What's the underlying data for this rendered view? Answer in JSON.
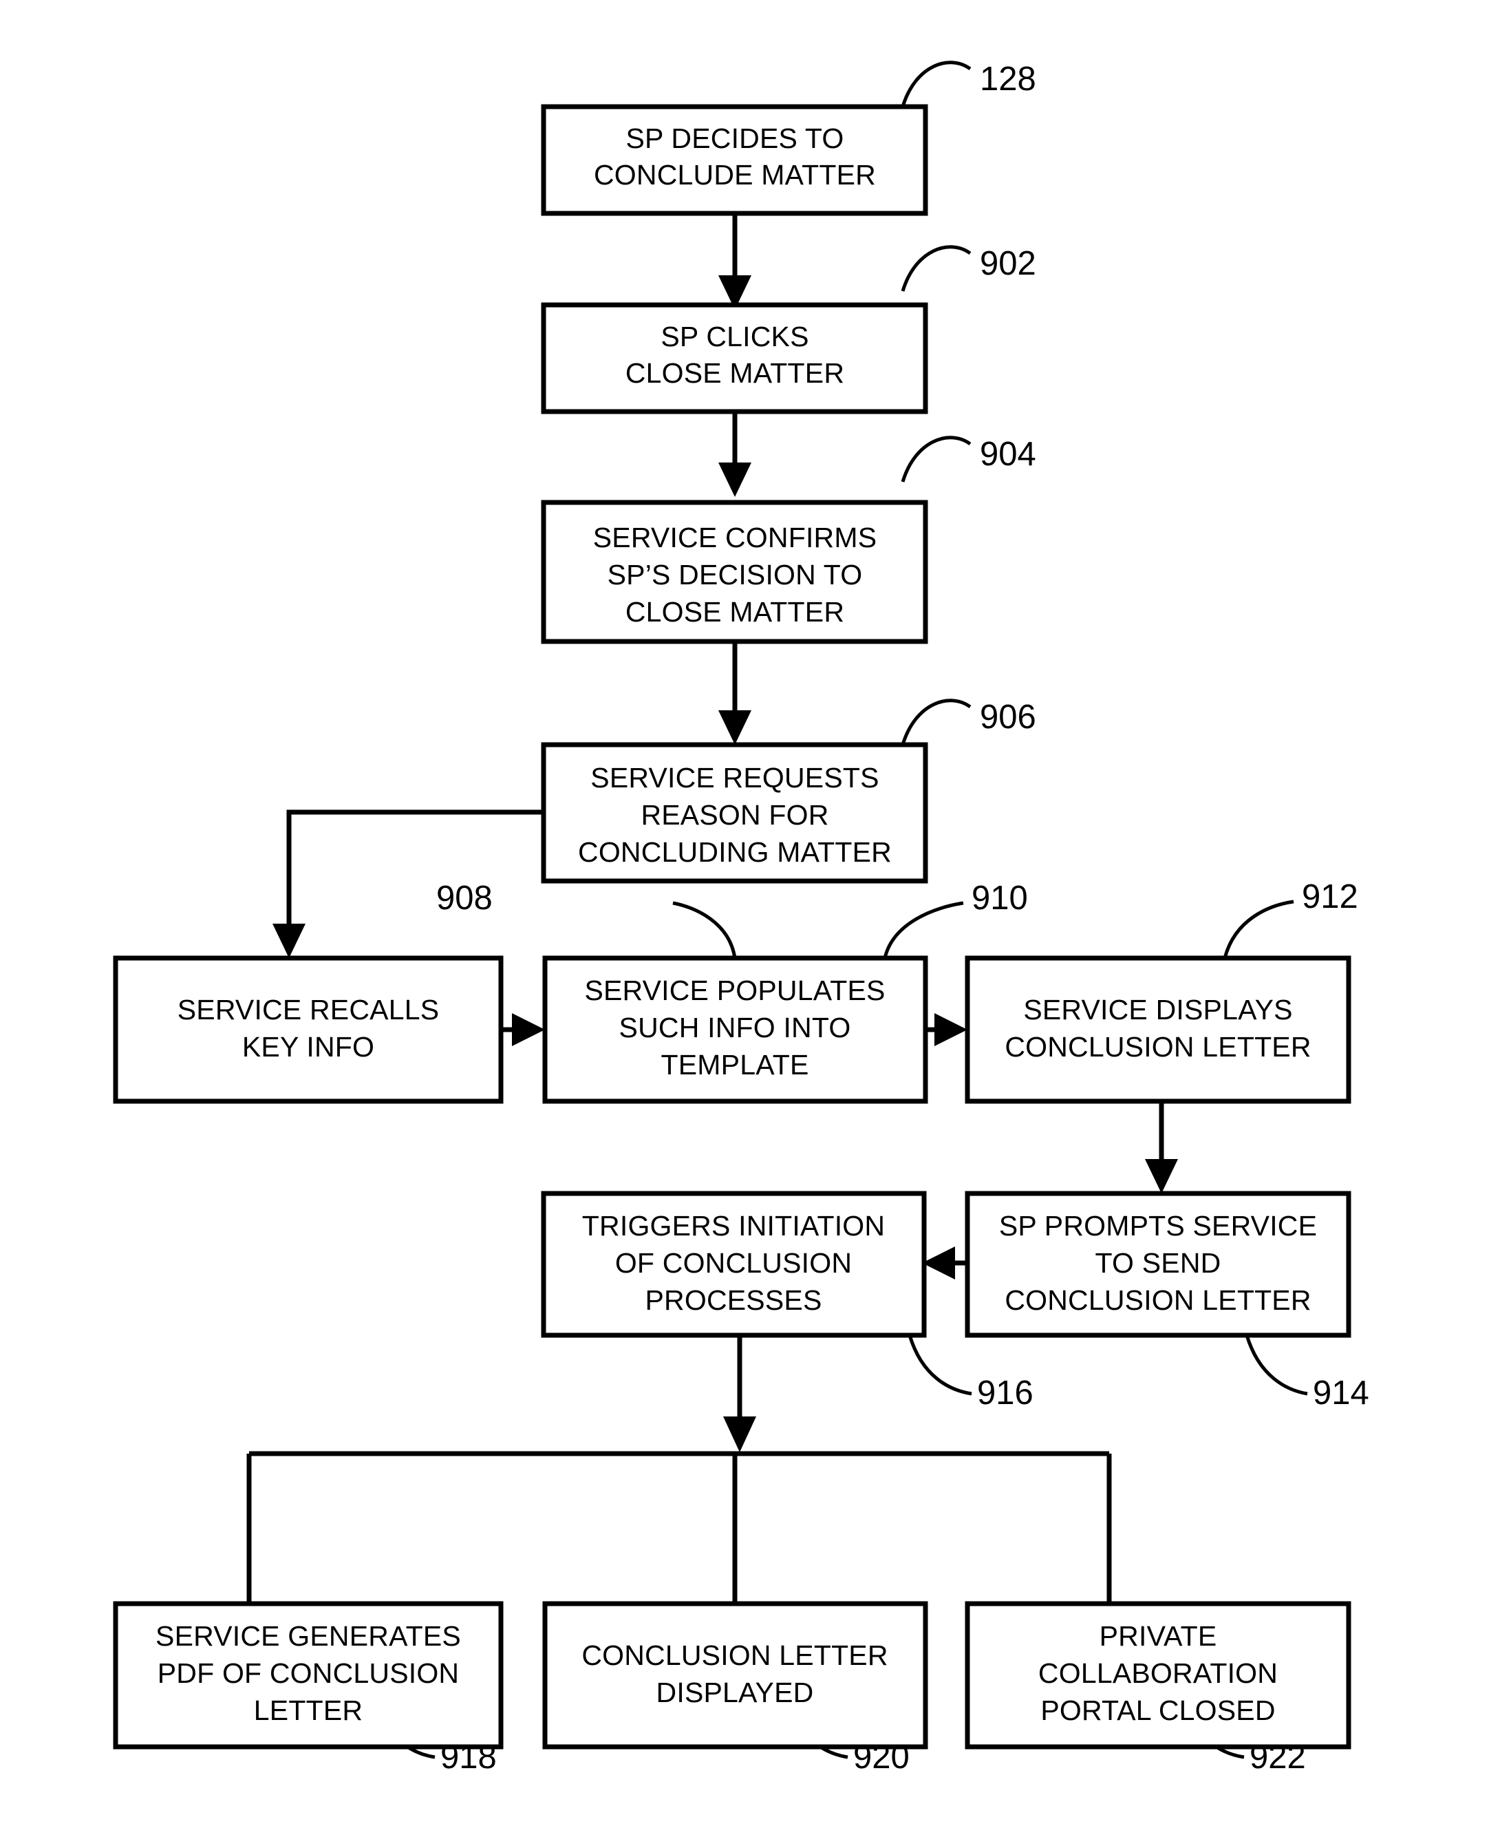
{
  "figure": {
    "kind": "patent-flowchart",
    "background_color": "#ffffff",
    "line_color": "#000000"
  },
  "nodes": [
    {
      "ref": "128",
      "lines": [
        "SP DECIDES TO",
        "CONCLUDE MATTER"
      ]
    },
    {
      "ref": "902",
      "lines": [
        "SP CLICKS",
        "CLOSE MATTER"
      ]
    },
    {
      "ref": "904",
      "lines": [
        "SERVICE CONFIRMS",
        "SP’S DECISION TO",
        "CLOSE MATTER"
      ]
    },
    {
      "ref": "906",
      "lines": [
        "SERVICE REQUESTS",
        "REASON FOR",
        "CONCLUDING MATTER"
      ]
    },
    {
      "ref": "908",
      "lines": [
        "SERVICE RECALLS",
        "KEY INFO"
      ]
    },
    {
      "ref": "910",
      "lines": [
        "SERVICE POPULATES",
        "SUCH INFO INTO",
        "TEMPLATE"
      ]
    },
    {
      "ref": "912",
      "lines": [
        "SERVICE DISPLAYS",
        "CONCLUSION LETTER"
      ]
    },
    {
      "ref": "914",
      "lines": [
        "SP PROMPTS SERVICE",
        "TO SEND",
        "CONCLUSION LETTER"
      ]
    },
    {
      "ref": "916",
      "lines": [
        "TRIGGERS INITIATION",
        "OF CONCLUSION",
        "PROCESSES"
      ]
    },
    {
      "ref": "918",
      "lines": [
        "SERVICE GENERATES",
        "PDF OF CONCLUSION",
        "LETTER"
      ]
    },
    {
      "ref": "920",
      "lines": [
        "CONCLUSION LETTER",
        "DISPLAYED"
      ]
    },
    {
      "ref": "922",
      "lines": [
        "PRIVATE",
        "COLLABORATION",
        "PORTAL CLOSED"
      ]
    }
  ],
  "node_text": {
    "n128_l1": "SP DECIDES TO",
    "n128_l2": "CONCLUDE MATTER",
    "n902_l1": "SP CLICKS",
    "n902_l2": "CLOSE MATTER",
    "n904_l1": "SERVICE CONFIRMS",
    "n904_l2": "SP’S DECISION TO",
    "n904_l3": "CLOSE MATTER",
    "n906_l1": "SERVICE REQUESTS",
    "n906_l2": "REASON FOR",
    "n906_l3": "CONCLUDING MATTER",
    "n908_l1": "SERVICE RECALLS",
    "n908_l2": "KEY INFO",
    "n910_l1": "SERVICE POPULATES",
    "n910_l2": "SUCH INFO INTO",
    "n910_l3": "TEMPLATE",
    "n912_l1": "SERVICE DISPLAYS",
    "n912_l2": "CONCLUSION LETTER",
    "n914_l1": "SP PROMPTS SERVICE",
    "n914_l2": "TO SEND",
    "n914_l3": "CONCLUSION LETTER",
    "n916_l1": "TRIGGERS INITIATION",
    "n916_l2": "OF CONCLUSION",
    "n916_l3": "PROCESSES",
    "n918_l1": "SERVICE GENERATES",
    "n918_l2": "PDF OF CONCLUSION",
    "n918_l3": "LETTER",
    "n920_l1": "CONCLUSION LETTER",
    "n920_l2": "DISPLAYED",
    "n922_l1": "PRIVATE",
    "n922_l2": "COLLABORATION",
    "n922_l3": "PORTAL CLOSED"
  },
  "ref_labels": {
    "r128": "128",
    "r902": "902",
    "r904": "904",
    "r906": "906",
    "r908": "908",
    "r910": "910",
    "r912": "912",
    "r914": "914",
    "r916": "916",
    "r918": "918",
    "r920": "920",
    "r922": "922"
  },
  "edges": [
    {
      "from": "128",
      "to": "902",
      "style": "arrow-down"
    },
    {
      "from": "902",
      "to": "904",
      "style": "arrow-down"
    },
    {
      "from": "904",
      "to": "906",
      "style": "arrow-down"
    },
    {
      "from": "906",
      "to": "908",
      "style": "elbow-left-down-arrow"
    },
    {
      "from": "908",
      "to": "910",
      "style": "arrow-right"
    },
    {
      "from": "910",
      "to": "912",
      "style": "arrow-right"
    },
    {
      "from": "912",
      "to": "914",
      "style": "arrow-down"
    },
    {
      "from": "914",
      "to": "916",
      "style": "arrow-left"
    },
    {
      "from": "916",
      "to": "bus",
      "style": "arrow-down"
    },
    {
      "from": "bus",
      "to": "918",
      "style": "line-down"
    },
    {
      "from": "bus",
      "to": "920",
      "style": "line-down"
    },
    {
      "from": "bus",
      "to": "922",
      "style": "line-down"
    }
  ]
}
